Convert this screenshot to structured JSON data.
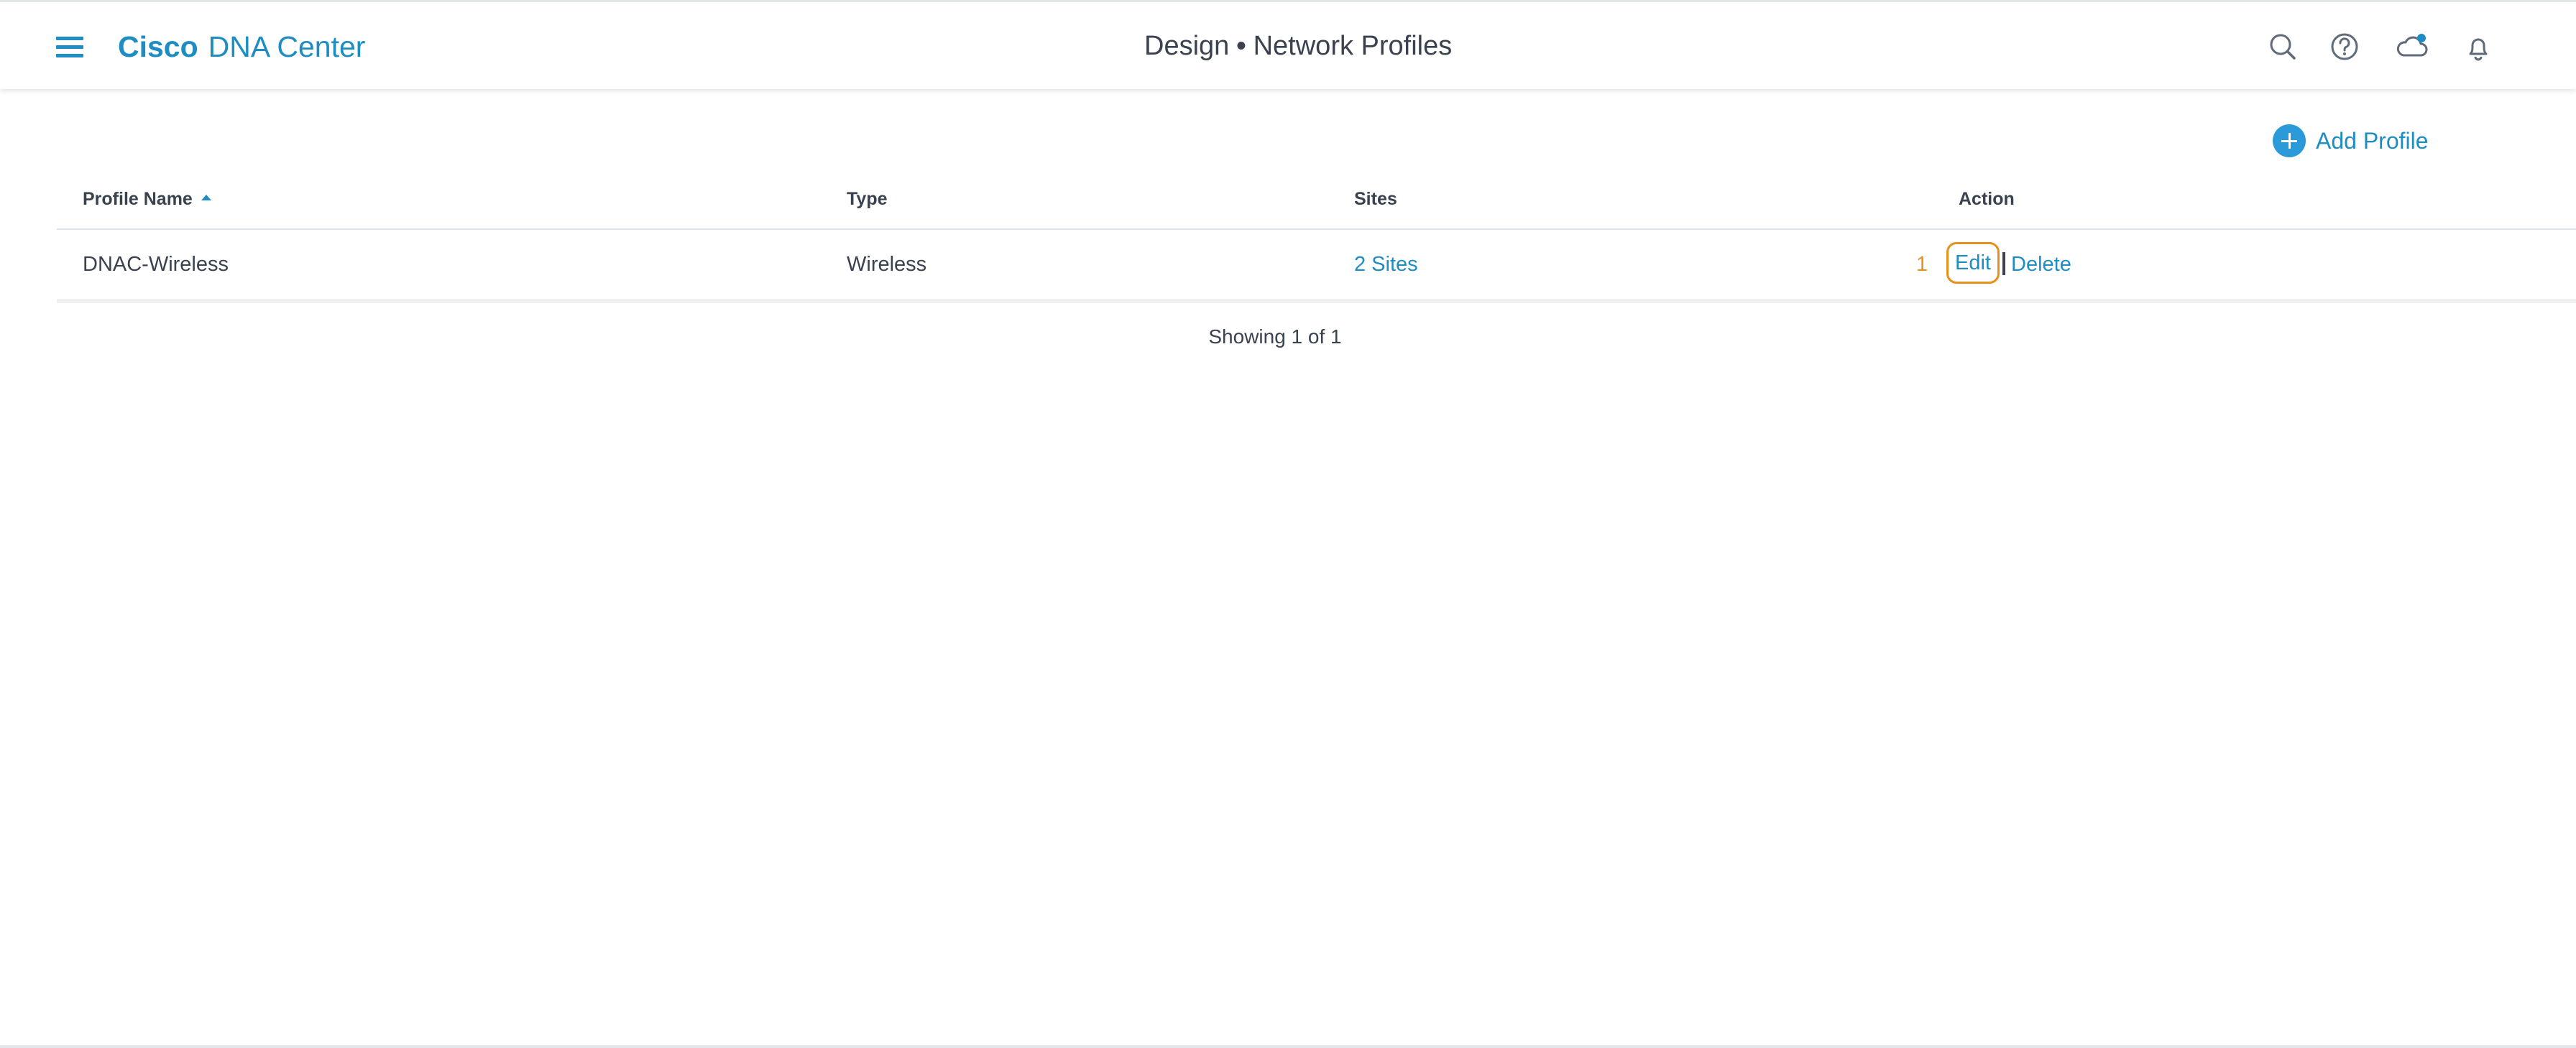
{
  "header": {
    "menu_icon": "hamburger-menu-icon",
    "brand_strong": "Cisco",
    "brand_light": "DNA Center",
    "breadcrumb_section": "Design",
    "breadcrumb_separator": "•",
    "breadcrumb_page": "Network Profiles",
    "icons": [
      "search-icon",
      "help-icon",
      "cloud-notification-icon",
      "bell-icon"
    ],
    "accent_color": "#1d8dc4"
  },
  "toolbar": {
    "add_profile_label": "Add Profile",
    "add_icon": "plus-circle-icon"
  },
  "table": {
    "columns": [
      {
        "label": "Profile Name",
        "sorted": "ascending"
      },
      {
        "label": "Type"
      },
      {
        "label": "Sites"
      },
      {
        "label": "Action"
      }
    ],
    "rows": [
      {
        "profile_name": "DNAC-Wireless",
        "type": "Wireless",
        "sites": "2 Sites",
        "marker": "1",
        "edit_label": "Edit",
        "delete_label": "Delete"
      }
    ],
    "footer": "Showing 1 of 1"
  },
  "colors": {
    "link": "#1d8dc4",
    "highlight": "#e8901c",
    "text": "#39424e"
  }
}
